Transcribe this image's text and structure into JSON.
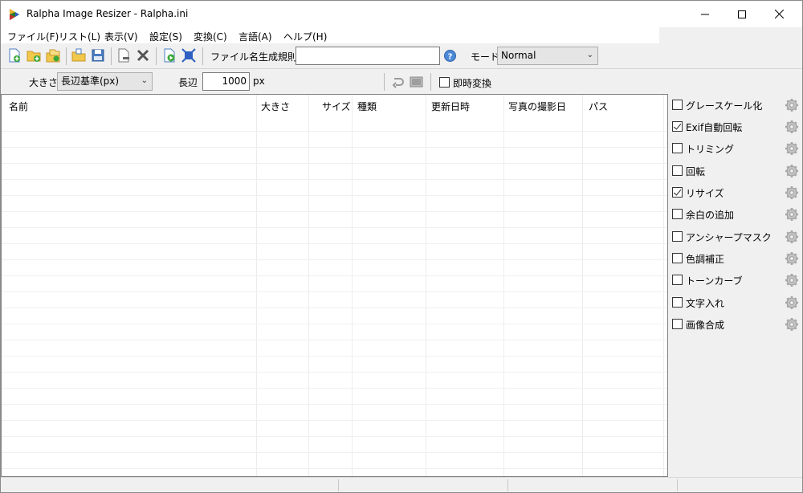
{
  "window": {
    "title": "Ralpha Image Resizer - Ralpha.ini"
  },
  "menu": [
    {
      "label": "ファイル(F)"
    },
    {
      "label": "リスト(L)"
    },
    {
      "label": "表示(V)"
    },
    {
      "label": "設定(S)"
    },
    {
      "label": "変換(C)"
    },
    {
      "label": "言語(A)"
    },
    {
      "label": "ヘルプ(H)"
    }
  ],
  "toolbar": {
    "filename_rule_label": "ファイル名生成規則",
    "filename_rule_value": "",
    "mode_label": "モード",
    "mode_value": "Normal"
  },
  "size_bar": {
    "size_label": "大きさ",
    "size_mode_value": "長辺基準(px)",
    "long_side_label": "長辺",
    "long_side_value": "1000",
    "unit": "px",
    "instant_convert_label": "即時変換",
    "instant_convert_checked": false
  },
  "columns": [
    {
      "label": "名前"
    },
    {
      "label": "大きさ"
    },
    {
      "label": "サイズ"
    },
    {
      "label": "種類"
    },
    {
      "label": "更新日時"
    },
    {
      "label": "写真の撮影日"
    },
    {
      "label": "パス"
    }
  ],
  "filters": [
    {
      "label": "グレースケール化",
      "checked": false
    },
    {
      "label": "Exif自動回転",
      "checked": true
    },
    {
      "label": "トリミング",
      "checked": false
    },
    {
      "label": "回転",
      "checked": false
    },
    {
      "label": "リサイズ",
      "checked": true
    },
    {
      "label": "余白の追加",
      "checked": false
    },
    {
      "label": "アンシャープマスク",
      "checked": false
    },
    {
      "label": "色調補正",
      "checked": false
    },
    {
      "label": "トーンカーブ",
      "checked": false
    },
    {
      "label": "文字入れ",
      "checked": false
    },
    {
      "label": "画像合成",
      "checked": false
    }
  ],
  "colors": {
    "window_bg": "#f0f0f0",
    "accent_blue": "#1e6fc8"
  }
}
